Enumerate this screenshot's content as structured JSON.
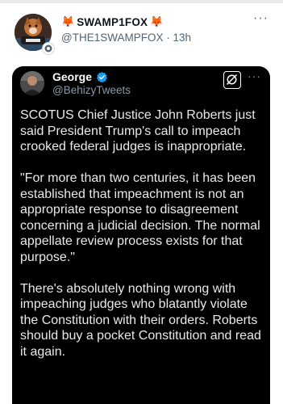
{
  "colors": {
    "accent_verified": "#1d9bf0",
    "card_background": "#000000",
    "text_dark": "#0f1419",
    "text_muted": "#536471"
  },
  "post": {
    "author": {
      "display_name": "SWAMP1FOX",
      "name_emoji_left": "🦊",
      "name_emoji_right": "🦊",
      "handle": "@THE1SWAMPFOX",
      "separator": "·",
      "timestamp": "13h",
      "avatar_icon": "profile-avatar",
      "badge_icon": "affiliate-badge-icon"
    },
    "more_label": "···"
  },
  "quoted": {
    "author": {
      "display_name": "George",
      "handle": "@BehizyTweets",
      "verified_icon": "verified-badge-icon"
    },
    "action_icon": "grok-icon",
    "more_label": "···",
    "paragraphs": [
      "SCOTUS Chief Justice John Roberts just said President Trump's call to impeach crooked federal judges is inappropriate.",
      "\"For more than two centuries, it has been established that impeachment is not an appropriate response to disagreement concerning a judicial decision. The normal appellate review process exists for that purpose.\"",
      "There's absolutely nothing wrong with impeaching judges who blatantly violate the Constitution with their orders. Roberts should buy a pocket Constitution and read it again."
    ]
  }
}
